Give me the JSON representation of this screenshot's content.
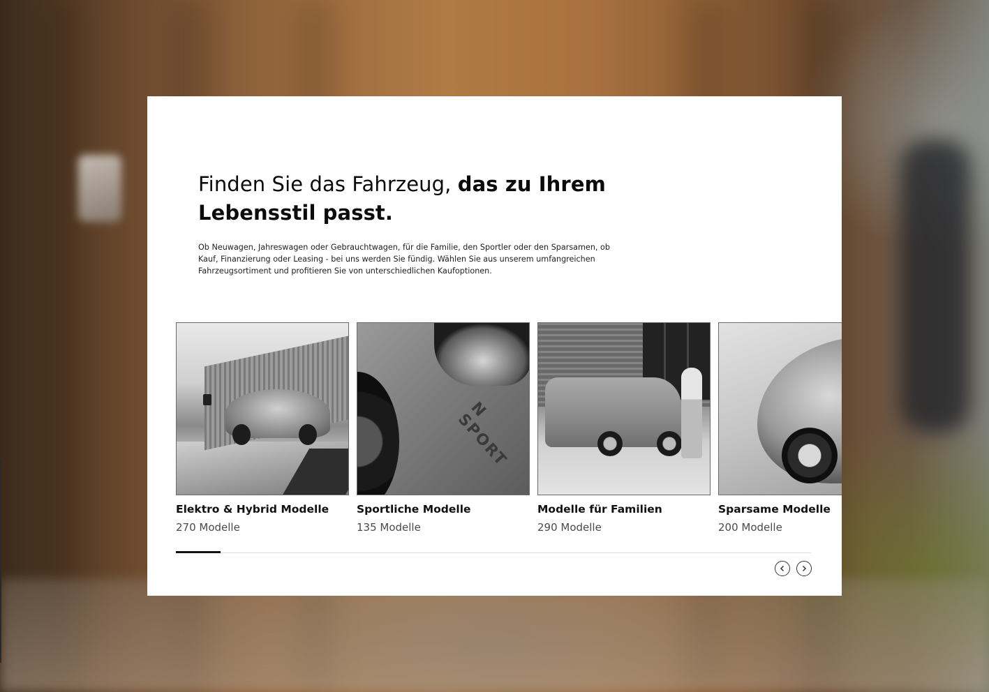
{
  "heading": {
    "regular": "Finden Sie das Fahrzeug, ",
    "bold": "das zu Ihrem Lebensstil passt."
  },
  "intro": "Ob Neuwagen, Jahreswagen oder Gebrauchtwagen, für die Familie, den Sportler oder den Sparsamen, ob Kauf, Finanzierung oder Leasing - bei uns werden Sie fündig. Wählen Sie aus unserem umfangreichen Fahrzeugsortiment und profitieren Sie von unterschiedlichen Kaufoptionen.",
  "categories": [
    {
      "title": "Elektro & Hybrid Modelle",
      "count": "270 Modelle"
    },
    {
      "title": "Sportliche Modelle",
      "count": "135 Modelle"
    },
    {
      "title": "Modelle für Familien",
      "count": "290 Modelle"
    },
    {
      "title": "Sparsame Modelle",
      "count": "200 Modelle"
    }
  ],
  "photo_text": {
    "sport_lettering": "N SPORT"
  },
  "slider": {
    "progress": 0.07
  },
  "icons": {
    "prev": "chevron-left-icon",
    "next": "chevron-right-icon"
  },
  "colors": {
    "text": "#0b0b0b",
    "muted": "#4a4a4a",
    "card_bg": "#ffffff",
    "track": "#dcdcdc",
    "progress": "#111111"
  }
}
